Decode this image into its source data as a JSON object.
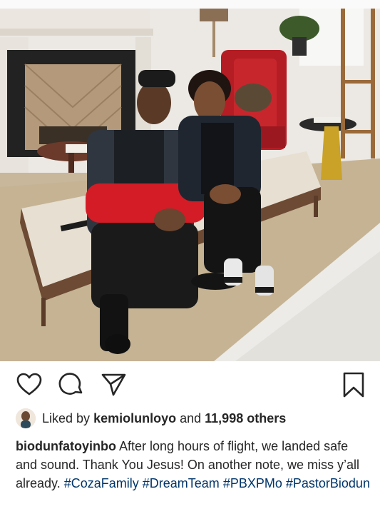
{
  "post": {
    "photo_alt": "",
    "actions": {
      "like_icon": "heart-outline-icon",
      "comment_icon": "speech-bubble-icon",
      "share_icon": "paper-plane-icon",
      "save_icon": "bookmark-icon"
    },
    "likes": {
      "prefix": "Liked by",
      "user": "kemiolunloyo",
      "connector": "and",
      "count": "11,998 others"
    },
    "caption": {
      "username": "biodunfatoyinbo",
      "text": " After long hours of flight, we landed safe and sound. Thank You Jesus! On another note, we miss y’all already. ",
      "hashtags": [
        "#CozaFamily",
        "#DreamTeam",
        "#PBXPMo",
        "#PastorBiodun"
      ]
    }
  },
  "colors": {
    "text": "#262626",
    "hashtag": "#003569",
    "icon": "#262626"
  }
}
